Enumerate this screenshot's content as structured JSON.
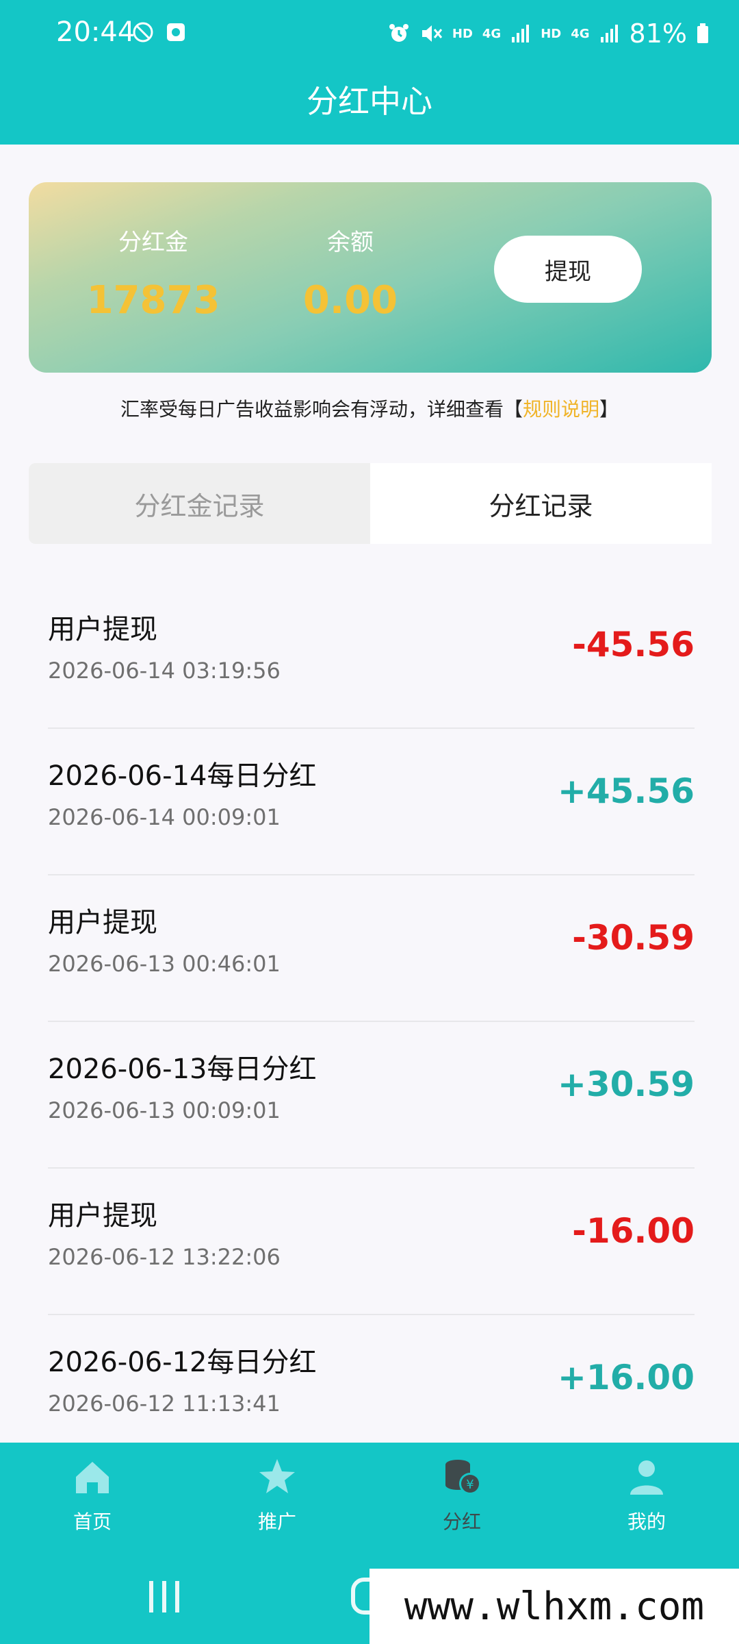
{
  "status_bar": {
    "time": "20:44",
    "battery": "81%",
    "network_tags": [
      "HD",
      "4G",
      "HD",
      "4G"
    ],
    "icons": [
      "do-not-disturb-icon",
      "app-notification-icon",
      "alarm-icon",
      "mute-icon",
      "signal-icon",
      "battery-icon"
    ]
  },
  "header": {
    "title": "分红中心"
  },
  "summary": {
    "dividend_label": "分红金",
    "dividend_value": "17873",
    "balance_label": "余额",
    "balance_value": "0.00",
    "withdraw_label": "提现"
  },
  "notice": {
    "text": "汇率受每日广告收益影响会有浮动，详细查看【",
    "link": "规则说明",
    "suffix": "】"
  },
  "tabs": [
    {
      "label": "分红金记录",
      "active": false
    },
    {
      "label": "分红记录",
      "active": true
    }
  ],
  "records": [
    {
      "title": "用户提现",
      "time": "2026-06-14 03:19:56",
      "amount": "-45.56",
      "type": "neg"
    },
    {
      "title": "2026-06-14每日分红",
      "time": "2026-06-14 00:09:01",
      "amount": "+45.56",
      "type": "pos"
    },
    {
      "title": "用户提现",
      "time": "2026-06-13 00:46:01",
      "amount": "-30.59",
      "type": "neg"
    },
    {
      "title": "2026-06-13每日分红",
      "time": "2026-06-13 00:09:01",
      "amount": "+30.59",
      "type": "pos"
    },
    {
      "title": "用户提现",
      "time": "2026-06-12 13:22:06",
      "amount": "-16.00",
      "type": "neg"
    },
    {
      "title": "2026-06-12每日分红",
      "time": "2026-06-12 11:13:41",
      "amount": "+16.00",
      "type": "pos"
    }
  ],
  "bottom_nav": [
    {
      "label": "首页",
      "icon": "home-icon",
      "active": false
    },
    {
      "label": "推广",
      "icon": "star-icon",
      "active": false
    },
    {
      "label": "分红",
      "icon": "coins-icon",
      "active": true
    },
    {
      "label": "我的",
      "icon": "user-icon",
      "active": false
    }
  ],
  "watermark": "www.wlhxm.com",
  "colors": {
    "primary": "#14c6c6",
    "gold": "#f4c236",
    "negative": "#e41b1b",
    "positive": "#22ada8"
  }
}
